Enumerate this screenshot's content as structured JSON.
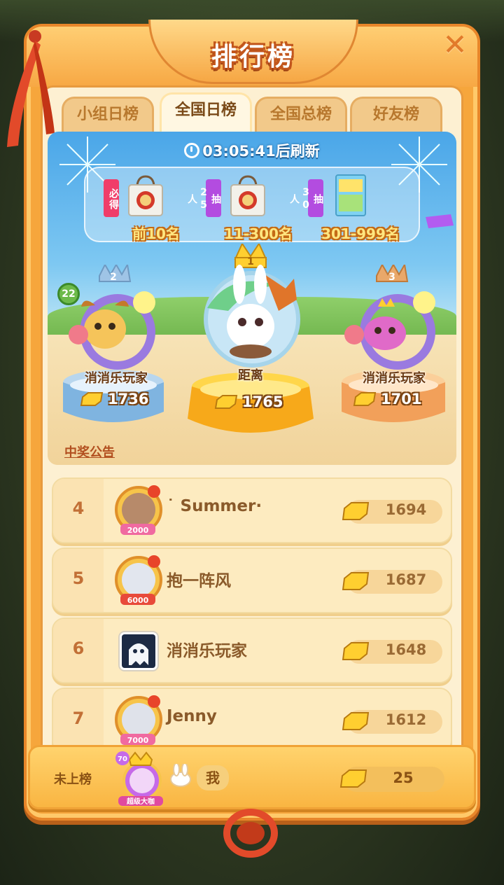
{
  "title": "排行榜",
  "tabs": [
    {
      "label": "小组日榜",
      "active": false
    },
    {
      "label": "全国日榜",
      "active": true
    },
    {
      "label": "全国总榜",
      "active": false
    },
    {
      "label": "好友榜",
      "active": false
    }
  ],
  "timer": "03:05:41后刷新",
  "prizes": [
    {
      "tag": "必得",
      "rank_label": "前10名",
      "icon": "tote-bag-icon"
    },
    {
      "tag": "抽25人",
      "rank_label": "11-300名",
      "icon": "tote-bag-icon"
    },
    {
      "tag": "抽30人",
      "rank_label": "301-999名",
      "icon": "book-icon"
    }
  ],
  "podium": {
    "first": {
      "rank": "1",
      "name": "距离",
      "score": "1765"
    },
    "second": {
      "rank": "2",
      "name": "消消乐玩家",
      "score": "1736",
      "level": "22"
    },
    "third": {
      "rank": "3",
      "name": "消消乐玩家",
      "score": "1701"
    }
  },
  "notice_label": "中奖公告",
  "list": [
    {
      "rank": "4",
      "name": "˙ Summer·",
      "score": "1694",
      "frame_badge": "2000"
    },
    {
      "rank": "5",
      "name": "抱一阵风",
      "score": "1687",
      "frame_badge": "6000"
    },
    {
      "rank": "6",
      "name": "消消乐玩家",
      "score": "1648"
    },
    {
      "rank": "7",
      "name": "Jenny",
      "score": "1612",
      "frame_badge": "7000"
    }
  ],
  "me": {
    "status": "未上榜",
    "name": "我",
    "score": "25",
    "level": "70",
    "title_badge": "超级大咖"
  },
  "colors": {
    "accent": "#f6a63c",
    "panel_bg": "#fdf0d2",
    "gold": "#ffd34a"
  }
}
